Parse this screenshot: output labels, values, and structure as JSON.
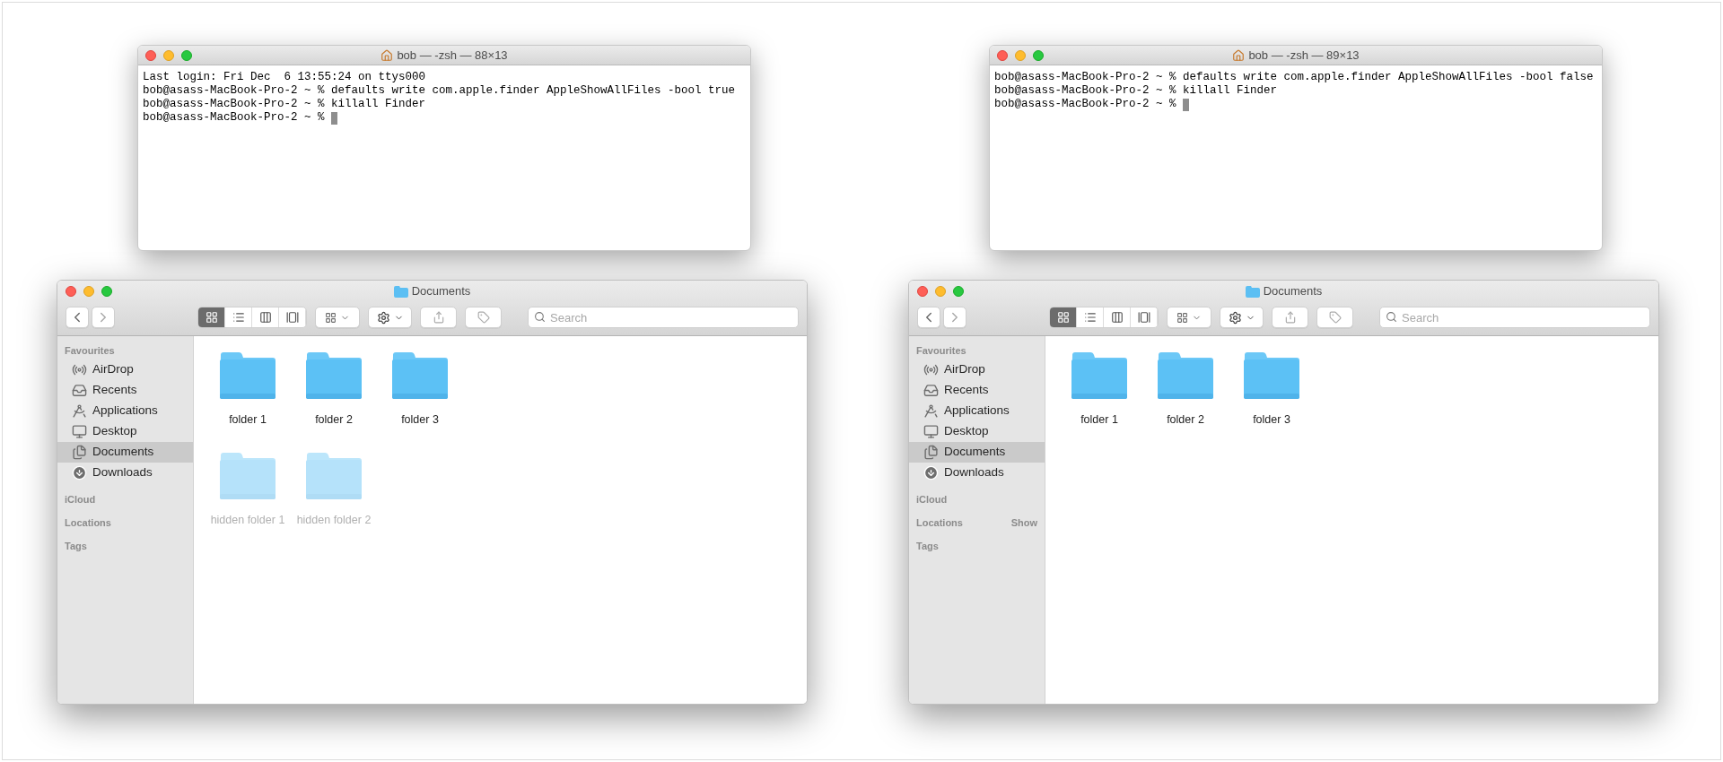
{
  "panels": [
    {
      "terminal": {
        "title": "bob — -zsh — 88×13",
        "lines": [
          "Last login: Fri Dec  6 13:55:24 on ttys000",
          "bob@asass-MacBook-Pro-2 ~ % defaults write com.apple.finder AppleShowAllFiles -bool true",
          "bob@asass-MacBook-Pro-2 ~ % killall Finder",
          "bob@asass-MacBook-Pro-2 ~ % "
        ]
      },
      "finder": {
        "title": "Documents",
        "views": [
          {
            "kind": "icons",
            "selected": true
          },
          {
            "kind": "list",
            "selected": false
          },
          {
            "kind": "columns",
            "selected": false
          },
          {
            "kind": "gallery",
            "selected": false
          }
        ],
        "search": {
          "placeholder": "Search"
        },
        "sidebar": [
          {
            "title": "Favourites",
            "items": [
              {
                "kind": "airdrop",
                "label": "AirDrop",
                "selected": false
              },
              {
                "kind": "recents",
                "label": "Recents",
                "selected": false
              },
              {
                "kind": "applications",
                "label": "Applications",
                "selected": false
              },
              {
                "kind": "desktop",
                "label": "Desktop",
                "selected": false
              },
              {
                "kind": "documents",
                "label": "Documents",
                "selected": true
              },
              {
                "kind": "downloads",
                "label": "Downloads",
                "selected": false
              }
            ]
          },
          {
            "title": "iCloud"
          },
          {
            "title": "Locations"
          },
          {
            "title": "Tags"
          }
        ],
        "file_rows": [
          [
            {
              "name": "folder 1",
              "hidden": false
            },
            {
              "name": "folder 2",
              "hidden": false
            },
            {
              "name": "folder 3",
              "hidden": false
            }
          ],
          [
            {
              "name": "hidden folder 1",
              "hidden": true
            },
            {
              "name": "hidden folder 2",
              "hidden": true
            }
          ]
        ]
      }
    },
    {
      "terminal": {
        "title": "bob — -zsh — 89×13",
        "lines": [
          "bob@asass-MacBook-Pro-2 ~ % defaults write com.apple.finder AppleShowAllFiles -bool false",
          "bob@asass-MacBook-Pro-2 ~ % killall Finder",
          "bob@asass-MacBook-Pro-2 ~ % "
        ]
      },
      "finder": {
        "title": "Documents",
        "views": [
          {
            "kind": "icons",
            "selected": true
          },
          {
            "kind": "list",
            "selected": false
          },
          {
            "kind": "columns",
            "selected": false
          },
          {
            "kind": "gallery",
            "selected": false
          }
        ],
        "search": {
          "placeholder": "Search"
        },
        "sidebar": [
          {
            "title": "Favourites",
            "items": [
              {
                "kind": "airdrop",
                "label": "AirDrop",
                "selected": false
              },
              {
                "kind": "recents",
                "label": "Recents",
                "selected": false
              },
              {
                "kind": "applications",
                "label": "Applications",
                "selected": false
              },
              {
                "kind": "desktop",
                "label": "Desktop",
                "selected": false
              },
              {
                "kind": "documents",
                "label": "Documents",
                "selected": true
              },
              {
                "kind": "downloads",
                "label": "Downloads",
                "selected": false
              }
            ]
          },
          {
            "title": "iCloud"
          },
          {
            "title": "Locations",
            "action": "Show"
          },
          {
            "title": "Tags"
          }
        ],
        "file_rows": [
          [
            {
              "name": "folder 1",
              "hidden": false
            },
            {
              "name": "folder 2",
              "hidden": false
            },
            {
              "name": "folder 3",
              "hidden": false
            }
          ]
        ]
      }
    }
  ]
}
